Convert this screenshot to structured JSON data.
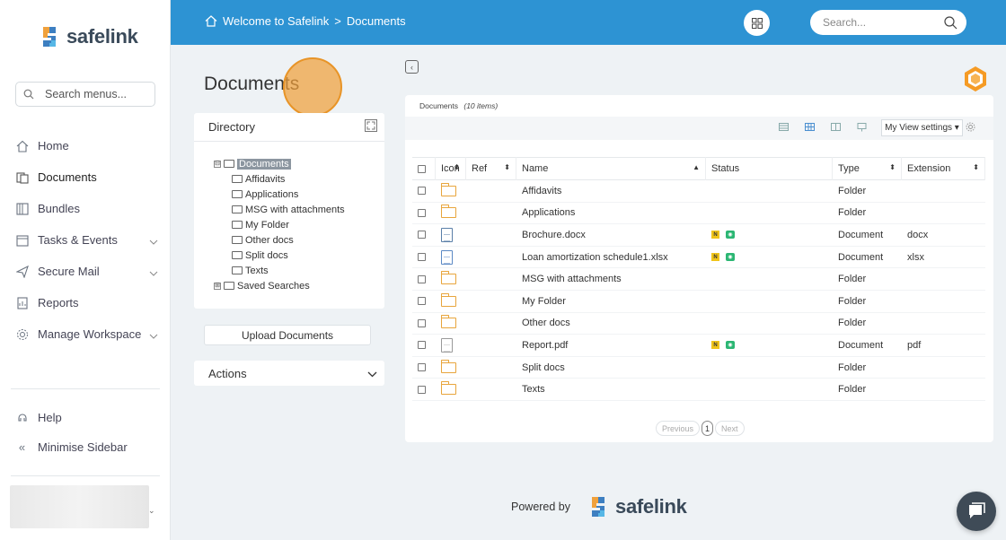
{
  "brand": {
    "name": "safelink"
  },
  "sidebar": {
    "search_placeholder": "Search menus...",
    "items": [
      {
        "label": "Home",
        "icon": "home-icon"
      },
      {
        "label": "Documents",
        "icon": "documents-icon"
      },
      {
        "label": "Bundles",
        "icon": "bundles-icon"
      },
      {
        "label": "Tasks & Events",
        "icon": "calendar-icon"
      },
      {
        "label": "Secure Mail",
        "icon": "send-icon"
      },
      {
        "label": "Reports",
        "icon": "reports-icon"
      },
      {
        "label": "Manage Workspace",
        "icon": "gear-icon"
      }
    ],
    "help": "Help",
    "minimise": "Minimise Sidebar",
    "minimise_glyph": "«"
  },
  "topbar": {
    "breadcrumb_home": "Welcome to Safelink",
    "breadcrumb_sep": ">",
    "breadcrumb_current": "Documents",
    "search_placeholder": "Search..."
  },
  "page": {
    "title": "Documents",
    "directory_title": "Directory",
    "tree": [
      {
        "label": "Documents",
        "level": 0,
        "toggle": "⊟",
        "selected": true
      },
      {
        "label": "Affidavits",
        "level": 1
      },
      {
        "label": "Applications",
        "level": 1
      },
      {
        "label": "MSG with attachments",
        "level": 1
      },
      {
        "label": "My Folder",
        "level": 1
      },
      {
        "label": "Other docs",
        "level": 1
      },
      {
        "label": "Split docs",
        "level": 1
      },
      {
        "label": "Texts",
        "level": 1
      },
      {
        "label": "Saved Searches",
        "level": 0,
        "toggle": "⊞"
      }
    ],
    "upload_label": "Upload Documents",
    "actions_label": "Actions"
  },
  "panel": {
    "caption": "Documents",
    "item_count": "(10 items)",
    "view_settings": "My View settings ▾",
    "columns": [
      "Icon",
      "Ref",
      "Name",
      "Status",
      "Type",
      "Extension"
    ],
    "rows": [
      {
        "icon": "folder",
        "name": "Affidavits",
        "status": false,
        "type": "Folder",
        "ext": ""
      },
      {
        "icon": "folder",
        "name": "Applications",
        "status": false,
        "type": "Folder",
        "ext": ""
      },
      {
        "icon": "docx",
        "name": "Brochure.docx",
        "status": true,
        "type": "Document",
        "ext": "docx"
      },
      {
        "icon": "xls",
        "name": "Loan amortization schedule1.xlsx",
        "status": true,
        "type": "Document",
        "ext": "xlsx"
      },
      {
        "icon": "folder",
        "name": "MSG with attachments",
        "status": false,
        "type": "Folder",
        "ext": ""
      },
      {
        "icon": "folder",
        "name": "My Folder",
        "status": false,
        "type": "Folder",
        "ext": ""
      },
      {
        "icon": "folder",
        "name": "Other docs",
        "status": false,
        "type": "Folder",
        "ext": ""
      },
      {
        "icon": "pdf",
        "name": "Report.pdf",
        "status": true,
        "type": "Document",
        "ext": "pdf"
      },
      {
        "icon": "folder",
        "name": "Split docs",
        "status": false,
        "type": "Folder",
        "ext": ""
      },
      {
        "icon": "folder",
        "name": "Texts",
        "status": false,
        "type": "Folder",
        "ext": ""
      }
    ],
    "badge_n": "N",
    "badge_eye": "◉",
    "pager_prev": "Previous",
    "pager_page": "1",
    "pager_next": "Next"
  },
  "footer": {
    "powered_by": "Powered by",
    "brand": "safelink"
  },
  "colors": {
    "topbar": "#2d93d3",
    "accent_orange": "#e8a53c",
    "chat": "#3f4b57"
  }
}
